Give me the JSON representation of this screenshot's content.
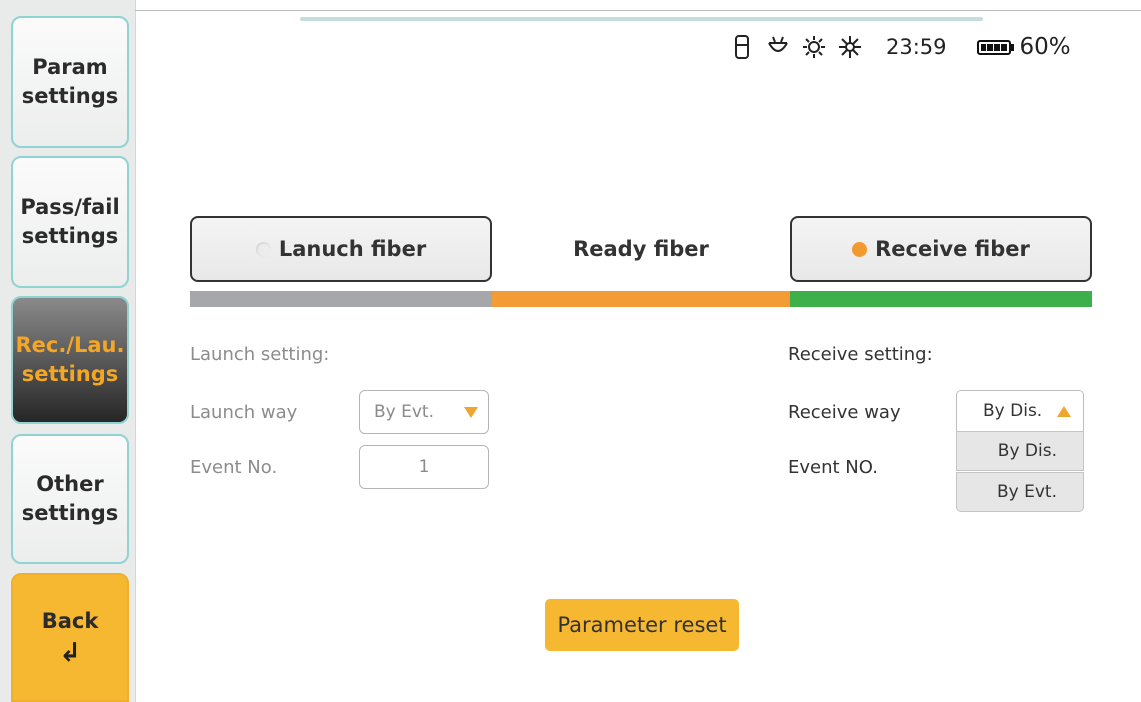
{
  "sidebar": {
    "param_line1": "Param",
    "param_line2": "settings",
    "pass_line1": "Pass/fail",
    "pass_line2": "settings",
    "rec_line1": "Rec./Lau.",
    "rec_line2": "settings",
    "other_line1": "Other",
    "other_line2": "settings",
    "back_label": "Back",
    "back_arrow": "↲"
  },
  "status": {
    "time": "23:59",
    "battery_pct": "60%",
    "battery_level": 0.6,
    "icons": [
      "usb-icon",
      "vfl-icon",
      "brightness-icon",
      "sun-icon"
    ]
  },
  "fiber": {
    "launch": "Lanuch fiber",
    "ready": "Ready fiber",
    "receive": "Receive fiber",
    "colors": {
      "launch": "#a6a7aa",
      "ready": "#f39b35",
      "receive": "#3db049"
    }
  },
  "launch": {
    "section": "Launch setting:",
    "way_label": "Launch way",
    "way_value": "By Evt.",
    "event_label": "Event No.",
    "event_value": "1"
  },
  "receive": {
    "section": "Receive setting:",
    "way_label": "Receive way",
    "way_value": "By Dis.",
    "event_label": "Event NO.",
    "options": [
      "By Dis.",
      "By Evt."
    ]
  },
  "reset_label": "Parameter reset",
  "accent": "#f6b731"
}
